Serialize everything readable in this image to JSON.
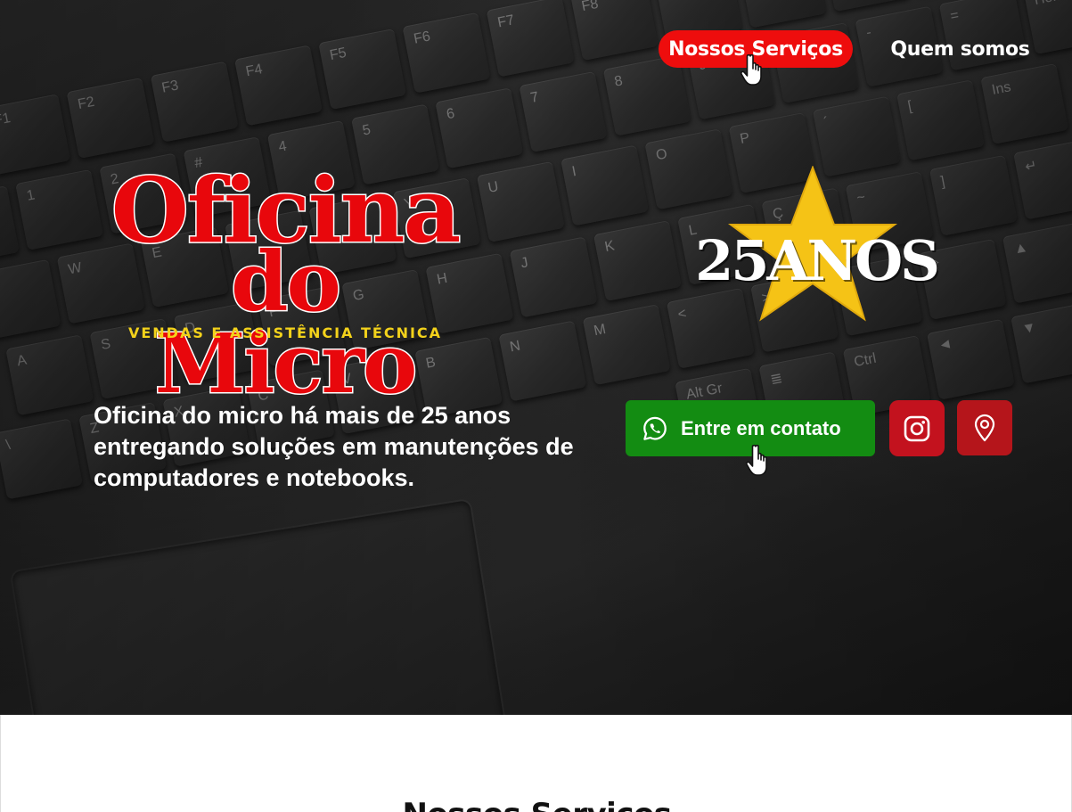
{
  "nav": {
    "services_label": "Nossos Serviços",
    "about_label": "Quem somos"
  },
  "logo": {
    "line1": "Oficina",
    "line2": "do Micro",
    "subtitle": "VENDAS E ASSISTÊNCIA TÉCNICA"
  },
  "badge": {
    "text": "25ANOS"
  },
  "hero": {
    "tagline": "Oficina do micro há mais de 25 anos entregando soluções em manutenções de computadores e notebooks."
  },
  "contact": {
    "whatsapp_label": "Entre em contato",
    "whatsapp_icon": "whatsapp-icon",
    "instagram_icon": "instagram-icon",
    "map_icon": "map-pin-icon"
  },
  "section": {
    "title": "Nossos Serviços"
  },
  "colors": {
    "brand_red": "#ee0d0d",
    "whatsapp_green": "#138c12",
    "instagram_red": "#c3121e",
    "map_red": "#b5151b",
    "star_yellow": "#f5c316",
    "subtitle_yellow": "#f3d21b"
  }
}
